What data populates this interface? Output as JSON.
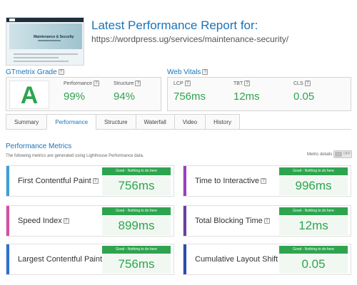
{
  "header": {
    "title": "Latest Performance Report for:",
    "url": "https://wordpress.ug/services/maintenance-security/",
    "thumbnail_title": "Maintenance & Security"
  },
  "gtmetrix": {
    "label": "GTmetrix Grade",
    "grade": "A",
    "metrics": [
      {
        "label": "Performance",
        "value": "99%"
      },
      {
        "label": "Structure",
        "value": "94%"
      }
    ]
  },
  "vitals": {
    "label": "Web Vitals",
    "metrics": [
      {
        "label": "LCP",
        "value": "756ms"
      },
      {
        "label": "TBT",
        "value": "12ms"
      },
      {
        "label": "CLS",
        "value": "0.05"
      }
    ]
  },
  "tabs": [
    "Summary",
    "Performance",
    "Structure",
    "Waterfall",
    "Video",
    "History"
  ],
  "active_tab": "Performance",
  "performance": {
    "title": "Performance Metrics",
    "description": "The following metrics are generated using Lighthouse Performance data.",
    "metric_details_label": "Metric details",
    "toggle_state": "OFF"
  },
  "cards": [
    {
      "label": "First Contentful Paint",
      "status": "Good - Nothing to do here",
      "value": "756ms",
      "color": "#3aa0d8"
    },
    {
      "label": "Time to Interactive",
      "status": "Good - Nothing to do here",
      "value": "996ms",
      "color": "#9c3fbf"
    },
    {
      "label": "Speed Index",
      "status": "Good - Nothing to do here",
      "value": "899ms",
      "color": "#d84fa0"
    },
    {
      "label": "Total Blocking Time",
      "status": "Good - Nothing to do here",
      "value": "12ms",
      "color": "#6a3f9f"
    },
    {
      "label": "Largest Contentful Paint",
      "status": "Good - Nothing to do here",
      "value": "756ms",
      "color": "#2f6fd0"
    },
    {
      "label": "Cumulative Layout Shift",
      "status": "Good - Nothing to do here",
      "value": "0.05",
      "color": "#2a4fa8"
    }
  ],
  "colors": {
    "accent": "#1a73b8",
    "good": "#2ea44f"
  }
}
